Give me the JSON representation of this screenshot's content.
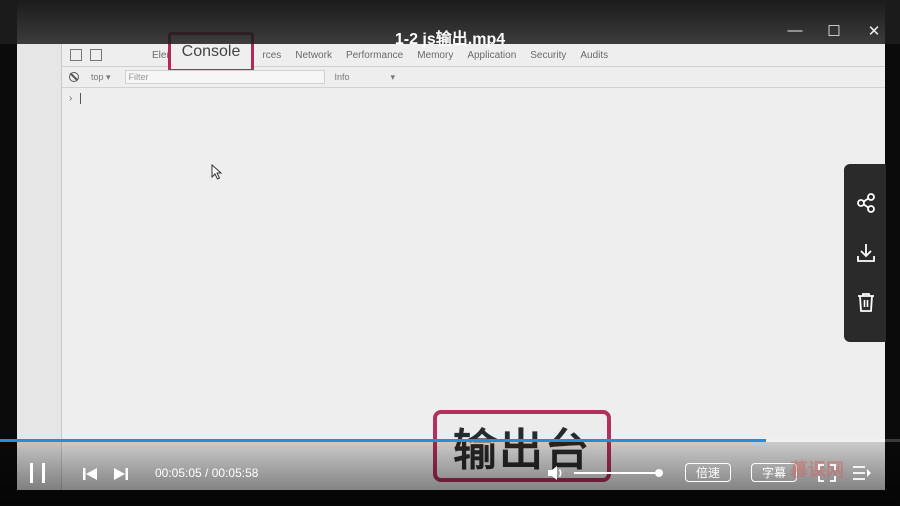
{
  "window": {
    "title": "1-2 js输出.mp4",
    "minimize_glyph": "—",
    "maximize_glyph": "☐",
    "close_glyph": "✕"
  },
  "video_frame": {
    "devtools": {
      "tabs": [
        "Eleme",
        "rces",
        "Network",
        "Performance",
        "Memory",
        "Application",
        "Security",
        "Audits"
      ],
      "console_tab": "Console",
      "context": "top ▾",
      "filter_placeholder": "Filter",
      "level": "Info",
      "level_arrow": "▾",
      "prompt": "›"
    },
    "stamp_text": "输出台"
  },
  "side_panel": {
    "icons": [
      "share-icon",
      "download-icon",
      "trash-icon"
    ]
  },
  "player": {
    "progress": 0.851,
    "current_time": "00:05:05",
    "duration": "00:05:58",
    "time_separator": " / ",
    "volume": 1.0,
    "speed_label": "倍速",
    "subtitle_label": "字幕",
    "watermark": "慕课网",
    "accent_color": "#1f8fe4"
  }
}
